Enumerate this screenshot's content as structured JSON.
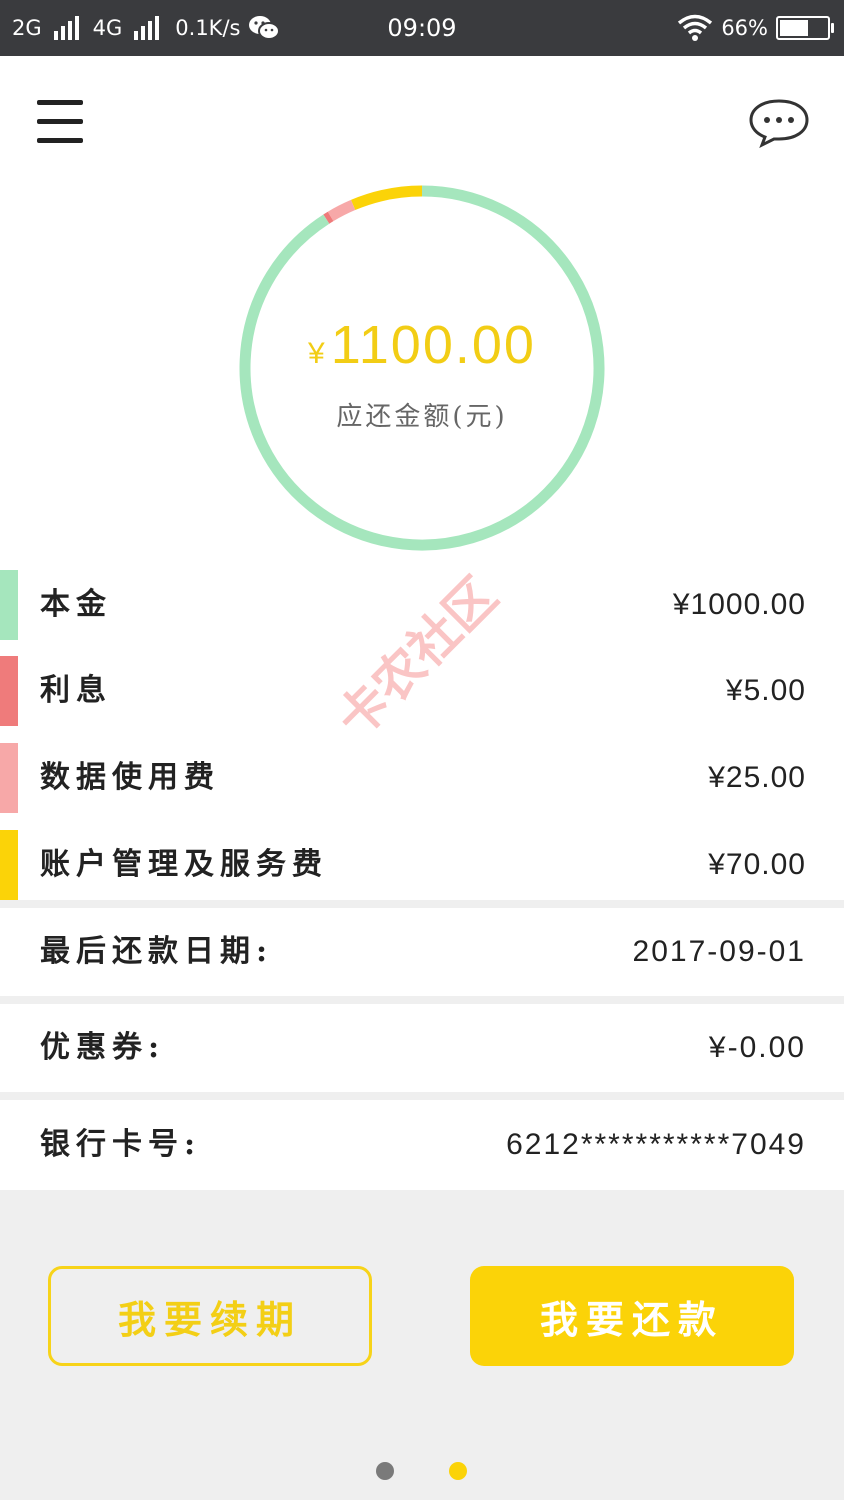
{
  "status_bar": {
    "net1": "2G",
    "net2": "4G",
    "speed": "0.1K/s",
    "time": "09:09",
    "battery": "66%",
    "battery_level": 0.66
  },
  "header": {
    "menu_icon": "hamburger-menu-icon",
    "chat_icon": "chat-bubble-icon"
  },
  "summary": {
    "currency": "¥",
    "amount": "1100.00",
    "label": "应还金额(元)",
    "ring_colors": {
      "principal": "#a5e6bd",
      "interest": "#ef7b7b",
      "data_fee": "#f7a8a8",
      "service_fee": "#fbd308"
    }
  },
  "fees": [
    {
      "label": "本金",
      "value": "¥1000.00",
      "amount": 1000,
      "color": "#a5e6bd"
    },
    {
      "label": "利息",
      "value": "¥5.00",
      "amount": 5,
      "color": "#ef7b7b"
    },
    {
      "label": "数据使用费",
      "value": "¥25.00",
      "amount": 25,
      "color": "#f7a8a8"
    },
    {
      "label": "账户管理及服务费",
      "value": "¥70.00",
      "amount": 70,
      "color": "#fbd308"
    }
  ],
  "details": {
    "due_date_label": "最后还款日期:",
    "due_date": "2017-09-01",
    "coupon_label": "优惠券:",
    "coupon": "¥-0.00",
    "card_label": "银行卡号:",
    "card": "6212***********7049"
  },
  "watermark": "卡农社区",
  "buttons": {
    "renew": "我要续期",
    "repay": "我要还款"
  },
  "pager": {
    "active_index": 1,
    "count": 2
  }
}
